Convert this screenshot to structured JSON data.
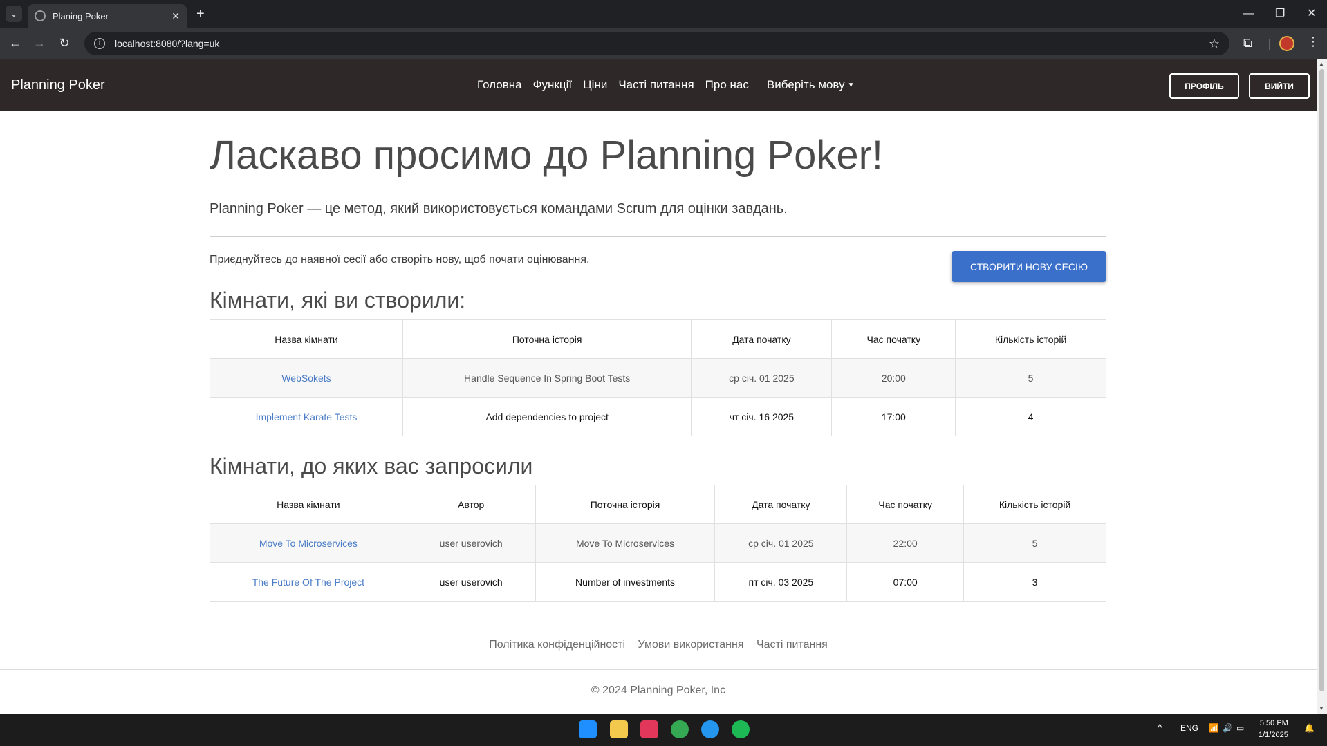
{
  "browser": {
    "tab_title": "Planing Poker",
    "url": "localhost:8080/?lang=uk"
  },
  "navbar": {
    "brand": "Planning Poker",
    "links": [
      "Головна",
      "Функції",
      "Ціни",
      "Часті питання",
      "Про нас"
    ],
    "language_dropdown": "Виберіть мову",
    "profile_button": "Профіль",
    "logout_button": "Вийти"
  },
  "hero": {
    "title": "Ласкаво просимо до Planning Poker!",
    "subtitle": "Planning Poker — це метод, який використовується командами Scrum для оцінки завдань."
  },
  "join": {
    "text": "Приєднуйтесь до наявної сесії або створіть нову, щоб почати оцінювання.",
    "create_button": "Створити нову сесію"
  },
  "created_rooms": {
    "title": "Кімнати, які ви створили:",
    "headers": [
      "Назва кімнати",
      "Поточна історія",
      "Дата початку",
      "Час початку",
      "Кількість історій"
    ],
    "rows": [
      [
        "WebSokets",
        "Handle Sequence In Spring Boot Tests",
        "ср січ. 01 2025",
        "20:00",
        "5"
      ],
      [
        "Implement Karate Tests",
        "Add dependencies to project",
        "чт січ. 16 2025",
        "17:00",
        "4"
      ]
    ]
  },
  "invited_rooms": {
    "title": "Кімнати, до яких вас запросили",
    "headers": [
      "Назва кімнати",
      "Автор",
      "Поточна історія",
      "Дата початку",
      "Час початку",
      "Кількість історій"
    ],
    "rows": [
      [
        "Move To Microservices",
        "user userovich",
        "Move To Microservices",
        "ср січ. 01 2025",
        "22:00",
        "5"
      ],
      [
        "The Future Of The Project",
        "user userovich",
        "Number of investments",
        "пт січ. 03 2025",
        "07:00",
        "3"
      ]
    ]
  },
  "footer": {
    "links": [
      "Політика конфіденційності",
      "Умови використання",
      "Часті питання"
    ],
    "copyright": "© 2024 Planning Poker, Inc"
  },
  "taskbar": {
    "language": "ENG",
    "time": "5:50 PM",
    "date": "1/1/2025"
  }
}
